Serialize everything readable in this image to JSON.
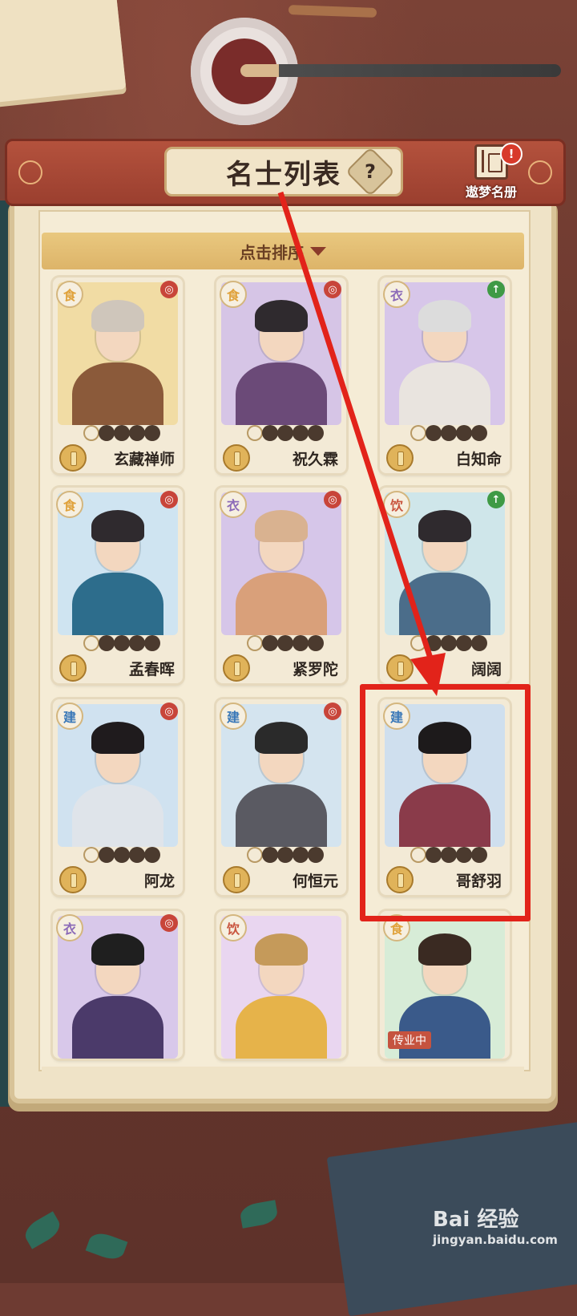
{
  "header": {
    "title": "名士列表",
    "help_glyph": "?",
    "dream_book_label": "遨梦名册",
    "alert_glyph": "!"
  },
  "sort": {
    "label": "点击排序"
  },
  "cards": [
    {
      "name": "玄藏禅师",
      "category": "食",
      "category_color": "#e0a23c",
      "corner": "red",
      "stars_filled": 4,
      "palette": {
        "bg": "#f1dca4",
        "hair": "#cfc6bb",
        "body": "#8b5a3a"
      }
    },
    {
      "name": "祝久霖",
      "category": "食",
      "category_color": "#e0a23c",
      "corner": "red",
      "stars_filled": 4,
      "palette": {
        "bg": "#d6c5e6",
        "hair": "#2f2a2e",
        "body": "#6b4a78"
      }
    },
    {
      "name": "白知命",
      "category": "衣",
      "category_color": "#8c6bb8",
      "corner": "green",
      "stars_filled": 4,
      "palette": {
        "bg": "#d7c6e9",
        "hair": "#dcdcdc",
        "body": "#e9e4df"
      }
    },
    {
      "name": "孟春晖",
      "category": "食",
      "category_color": "#e0a23c",
      "corner": "red",
      "stars_filled": 4,
      "palette": {
        "bg": "#cfe4f1",
        "hair": "#2f2a2e",
        "body": "#2d6d8c"
      }
    },
    {
      "name": "紧罗陀",
      "category": "衣",
      "category_color": "#8c6bb8",
      "corner": "red",
      "stars_filled": 4,
      "palette": {
        "bg": "#d6c6e9",
        "hair": "#d9b290",
        "body": "#d9a07a"
      }
    },
    {
      "name": "阔阔",
      "category": "饮",
      "category_color": "#c9553f",
      "corner": "green",
      "stars_filled": 4,
      "palette": {
        "bg": "#cfe6ea",
        "hair": "#2f2a2e",
        "body": "#4b6d8a"
      }
    },
    {
      "name": "阿龙",
      "category": "建",
      "category_color": "#3a78b8",
      "corner": "red",
      "stars_filled": 4,
      "palette": {
        "bg": "#d0e2f0",
        "hair": "#1f1b1d",
        "body": "#dfe4ea"
      }
    },
    {
      "name": "何恒元",
      "category": "建",
      "category_color": "#3a78b8",
      "corner": "red",
      "stars_filled": 4,
      "palette": {
        "bg": "#d4e4ef",
        "hair": "#2a2a2a",
        "body": "#5a5a62"
      }
    },
    {
      "name": "哥舒羽",
      "category": "建",
      "category_color": "#3a78b8",
      "corner": "none",
      "stars_filled": 4,
      "palette": {
        "bg": "#cfdfee",
        "hair": "#1d1a1b",
        "body": "#8a3b4a"
      }
    },
    {
      "name": "",
      "category": "衣",
      "category_color": "#8c6bb8",
      "corner": "red",
      "stars_filled": 4,
      "palette": {
        "bg": "#d8c8ea",
        "hair": "#1f1f1f",
        "body": "#4b3a6a"
      }
    },
    {
      "name": "",
      "category": "饮",
      "category_color": "#c9553f",
      "corner": "none",
      "stars_filled": 4,
      "palette": {
        "bg": "#e9d6f0",
        "hair": "#c59a5a",
        "body": "#e6b34a"
      }
    },
    {
      "name": "",
      "category": "食",
      "category_color": "#e0a23c",
      "corner": "none",
      "stars_filled": 4,
      "palette": {
        "bg": "#d7ecd7",
        "hair": "#3a2a22",
        "body": "#3a5a8a"
      },
      "status_tag": "传业中"
    }
  ],
  "watermark": {
    "brand": "Bai 经验",
    "site": "jingyan.baidu.com"
  },
  "colors": {
    "highlight": "#e2231a",
    "accent_red": "#9b3f2f",
    "panel": "#efe3c7"
  }
}
